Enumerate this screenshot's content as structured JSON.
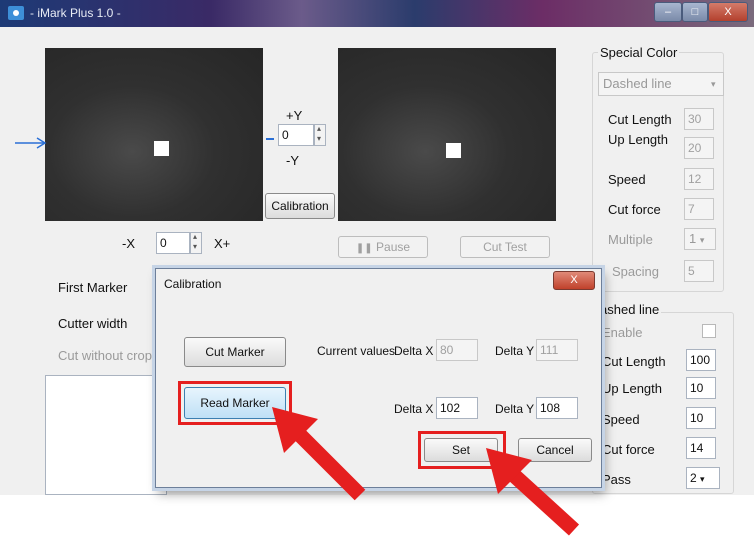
{
  "window": {
    "title": "- iMark Plus 1.0 -",
    "controls": {
      "minimize": "–",
      "maximize": "□",
      "close": "X"
    }
  },
  "camera": {
    "y_plus": "+Y",
    "y_minus": "-Y",
    "y_value": "0",
    "x_minus": "-X",
    "x_plus": "X+",
    "x_value": "0",
    "calibration_button": "Calibration",
    "pause_button": "Pause",
    "cut_test_button": "Cut Test"
  },
  "left_panel": {
    "first_marker": "First Marker",
    "cutter_width": "Cutter width",
    "cut_without_crop": "Cut without crop m"
  },
  "special_color": {
    "title": "Special Color",
    "line_type": "Dashed line",
    "cut_length_label": "Cut Length",
    "cut_length": "30",
    "up_length_label": "Up Length",
    "up_length": "20",
    "speed_label": "Speed",
    "speed": "12",
    "cutforce_label": "Cut force",
    "cutforce": "7",
    "multiple_label": "Multiple",
    "multiple": "1",
    "spacing_label": "Spacing",
    "spacing": "5"
  },
  "dashed_line": {
    "title": "ashed line",
    "enable_label": "Enable",
    "cut_length_label": "Cut Length",
    "cut_length": "100",
    "up_length_label": "Up Length",
    "up_length": "10",
    "speed_label": "Speed",
    "speed": "10",
    "cutforce_label": "Cut force",
    "cutforce": "14",
    "pass_label": "Pass",
    "pass": "2"
  },
  "dialog": {
    "title": "Calibration",
    "close": "X",
    "cut_marker_button": "Cut Marker",
    "read_marker_button": "Read Marker",
    "current_values_label": "Current values",
    "delta_x_label": "Delta X",
    "delta_y_label": "Delta Y",
    "current_delta_x": "80",
    "current_delta_y": "111",
    "new_delta_x": "102",
    "new_delta_y": "108",
    "set_button": "Set",
    "cancel_button": "Cancel"
  },
  "colors": {
    "highlight": "#e51f1f",
    "arrow": "#e51f1f",
    "blue_arrow": "#2a6fd6"
  }
}
